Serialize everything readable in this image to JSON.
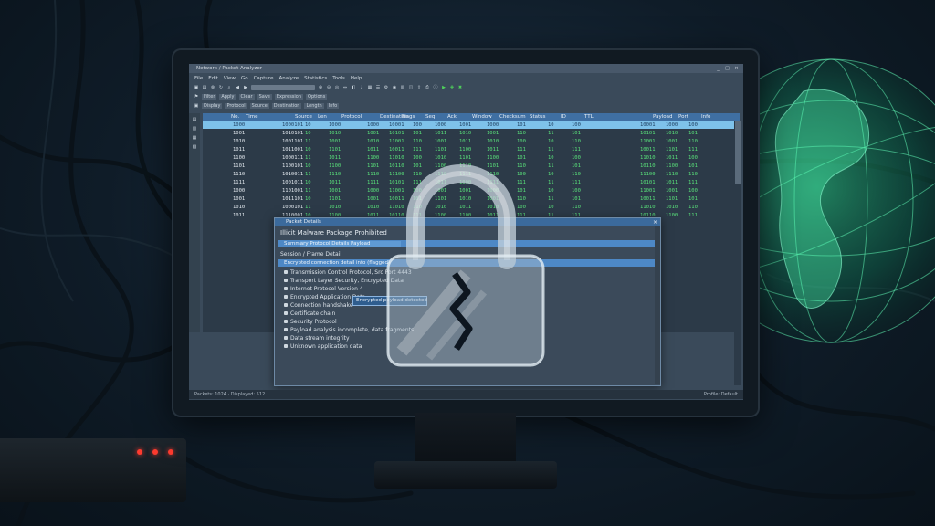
{
  "window": {
    "title": "Network / Packet Analyzer",
    "controls": [
      "_",
      "□",
      "×"
    ]
  },
  "menu": [
    "File",
    "Edit",
    "View",
    "Go",
    "Capture",
    "Analyze",
    "Statistics",
    "Tools",
    "Help"
  ],
  "toolbar2": {
    "filter_buttons": [
      "Filter",
      "Apply",
      "Clear",
      "Save",
      "Expression",
      "Options"
    ]
  },
  "toolbar3": {
    "labels": [
      "Display",
      "Protocol",
      "Source",
      "Destination",
      "Length",
      "Info"
    ]
  },
  "grid": {
    "headers": [
      "No.",
      "Time",
      "Source",
      "Len",
      "Protocol",
      "Destination",
      "Flags",
      "Seq",
      "Ack",
      "Window",
      "Checksum",
      "Status",
      "ID",
      "TTL",
      "Payload",
      "Port",
      "Info"
    ],
    "rows": [
      [
        "1000",
        "1000101",
        "10",
        "1000",
        "1000",
        "10001",
        "100",
        "1000",
        "1001",
        "1000",
        "101",
        "10",
        "100",
        "10001",
        "1000",
        "100"
      ],
      [
        "1001",
        "1010101",
        "10",
        "1010",
        "1001",
        "10101",
        "101",
        "1011",
        "1010",
        "1001",
        "110",
        "11",
        "101",
        "10101",
        "1010",
        "101"
      ],
      [
        "1010",
        "1001101",
        "11",
        "1001",
        "1010",
        "11001",
        "110",
        "1001",
        "1011",
        "1010",
        "100",
        "10",
        "110",
        "11001",
        "1001",
        "110"
      ],
      [
        "1011",
        "1011001",
        "10",
        "1101",
        "1011",
        "10011",
        "111",
        "1101",
        "1100",
        "1011",
        "111",
        "11",
        "111",
        "10011",
        "1101",
        "111"
      ],
      [
        "1100",
        "1000111",
        "11",
        "1011",
        "1100",
        "11010",
        "100",
        "1010",
        "1101",
        "1100",
        "101",
        "10",
        "100",
        "11010",
        "1011",
        "100"
      ],
      [
        "1101",
        "1100101",
        "10",
        "1100",
        "1101",
        "10110",
        "101",
        "1100",
        "1110",
        "1101",
        "110",
        "11",
        "101",
        "10110",
        "1100",
        "101"
      ],
      [
        "1110",
        "1010011",
        "11",
        "1110",
        "1110",
        "11100",
        "110",
        "1110",
        "1111",
        "1110",
        "100",
        "10",
        "110",
        "11100",
        "1110",
        "110"
      ],
      [
        "1111",
        "1001011",
        "10",
        "1011",
        "1111",
        "10101",
        "111",
        "1011",
        "1000",
        "1111",
        "111",
        "11",
        "111",
        "10101",
        "1011",
        "111"
      ],
      [
        "1000",
        "1101001",
        "11",
        "1001",
        "1000",
        "11001",
        "100",
        "1001",
        "1001",
        "1000",
        "101",
        "10",
        "100",
        "11001",
        "1001",
        "100"
      ],
      [
        "1001",
        "1011101",
        "10",
        "1101",
        "1001",
        "10011",
        "101",
        "1101",
        "1010",
        "1001",
        "110",
        "11",
        "101",
        "10011",
        "1101",
        "101"
      ],
      [
        "1010",
        "1000101",
        "11",
        "1010",
        "1010",
        "11010",
        "110",
        "1010",
        "1011",
        "1010",
        "100",
        "10",
        "110",
        "11010",
        "1010",
        "110"
      ],
      [
        "1011",
        "1110001",
        "10",
        "1100",
        "1011",
        "10110",
        "111",
        "1100",
        "1100",
        "1011",
        "111",
        "11",
        "111",
        "10110",
        "1100",
        "111"
      ]
    ]
  },
  "dialog": {
    "title": "Packet Details",
    "heading": "Illicit Malware Package Prohibited",
    "band1_label": "Summary Protocol Details Payload",
    "section_label": "Session / Frame Detail",
    "band2_label": "Encrypted connection detail info (flagged)",
    "lines": [
      "Transmission Control Protocol, Src Port 4443",
      "Transport Layer Security, Encrypted Data",
      "Internet Protocol Version 4",
      "Encrypted Application Data",
      "Connection handshake",
      "Certificate chain",
      "Security Protocol",
      "Payload analysis incomplete, data fragments",
      "Data stream integrity",
      "Unknown application data"
    ],
    "tooltip": "Encrypted payload detected"
  },
  "status": {
    "left": "Packets: 1024 · Displayed: 512",
    "right": "Profile: Default"
  },
  "colors": {
    "selection": "#7ec2ea",
    "header": "#3f6fa2",
    "accent_green": "#59e07a",
    "warning_led": "#ff3b2f"
  }
}
